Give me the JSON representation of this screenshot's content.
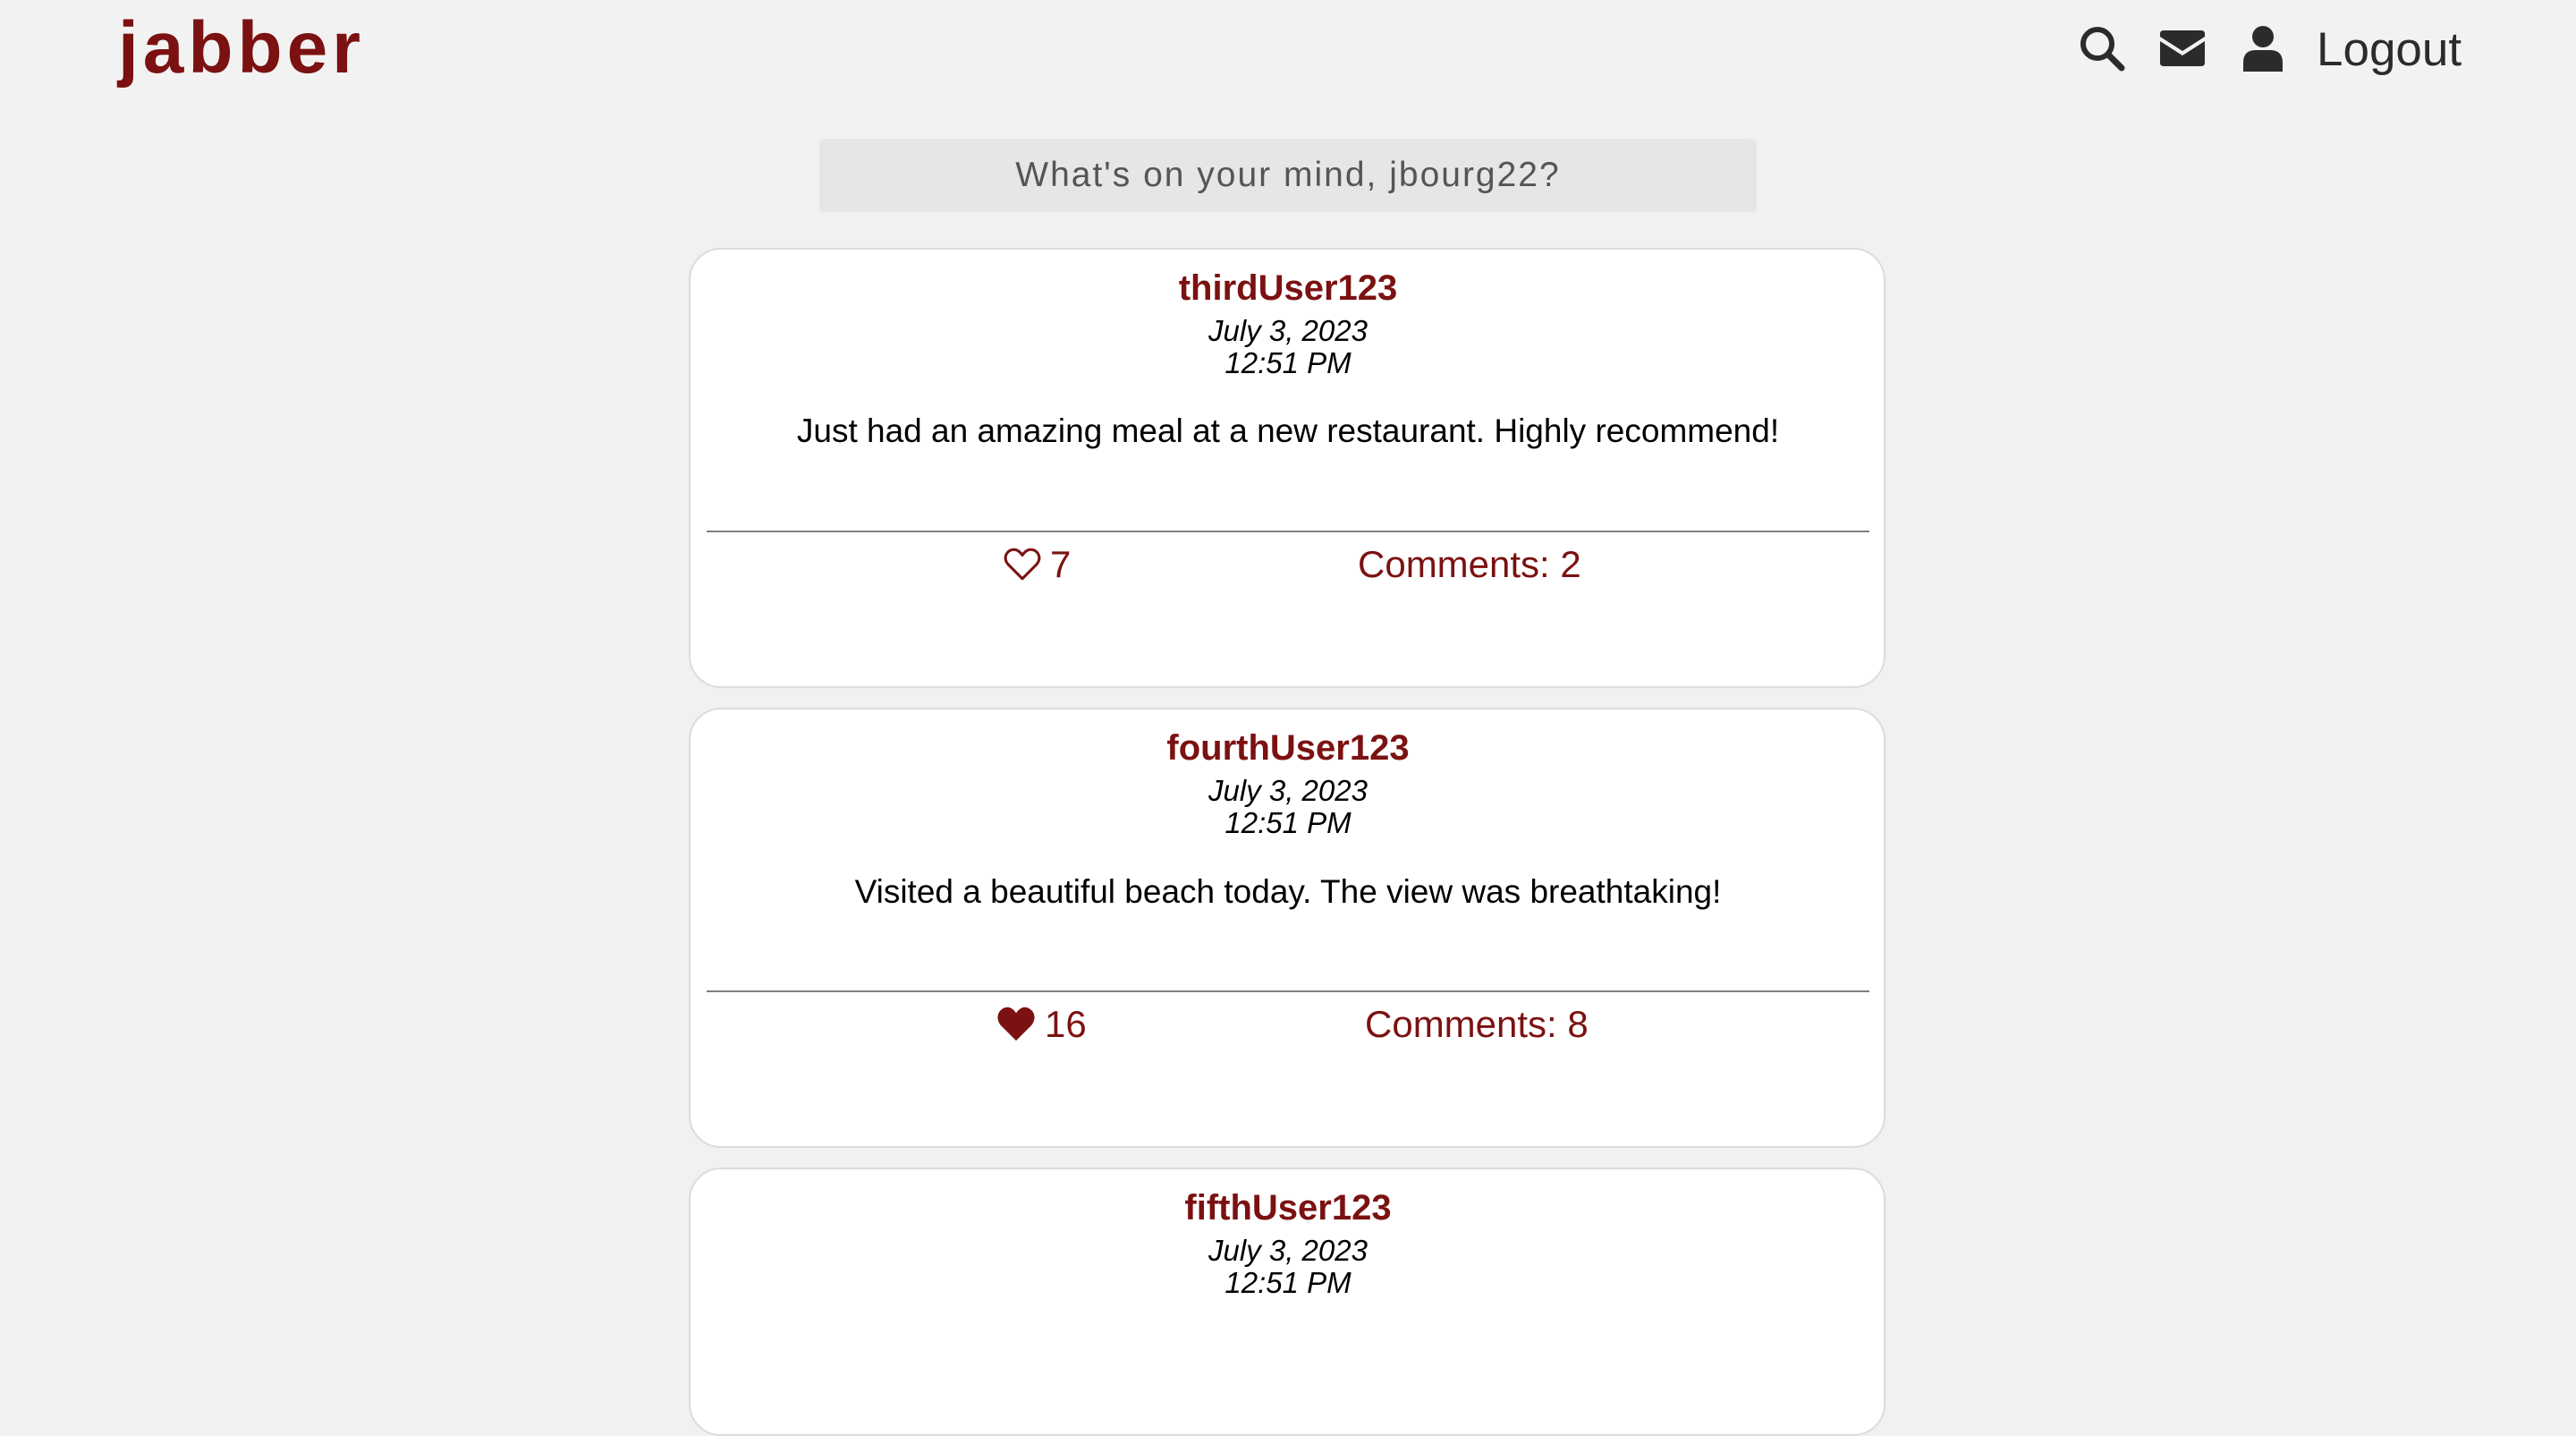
{
  "colors": {
    "brand": "#7b1111",
    "icon": "#2b2b2b",
    "page_background": "#f0f1f3"
  },
  "header": {
    "logo": "jabber",
    "icons": [
      "search-icon",
      "envelope-icon",
      "user-icon"
    ],
    "logout_label": "Logout"
  },
  "composer": {
    "placeholder": "What's on your mind, jbourg22?"
  },
  "posts": [
    {
      "username": "thirdUser123",
      "date": "July 3, 2023",
      "time": "12:51 PM",
      "body": "Just had an amazing meal at a new restaurant. Highly recommend!",
      "likes": "7",
      "liked": false,
      "comments_label": "Comments: 2"
    },
    {
      "username": "fourthUser123",
      "date": "July 3, 2023",
      "time": "12:51 PM",
      "body": "Visited a beautiful beach today. The view was breathtaking!",
      "likes": "16",
      "liked": true,
      "comments_label": "Comments: 8"
    },
    {
      "username": "fifthUser123",
      "date": "July 3, 2023",
      "time": "12:51 PM"
    }
  ]
}
